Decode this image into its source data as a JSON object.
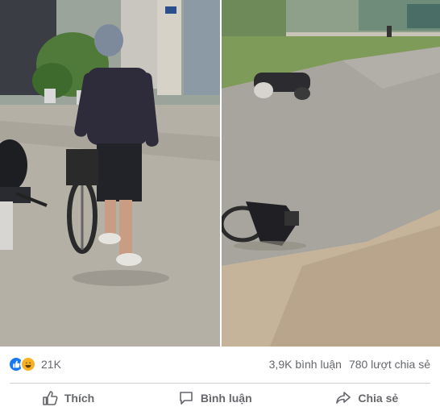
{
  "post": {
    "images": [
      {
        "alt_icon": "photo-man-with-bicycle"
      },
      {
        "alt_icon": "photo-crashed-motorbikes-road"
      }
    ]
  },
  "reactions": {
    "count": "21K",
    "icons": [
      "like-icon",
      "haha-icon"
    ]
  },
  "stats": {
    "comments": "3,9K bình luận",
    "shares": "780 lượt chia sẻ"
  },
  "actions": {
    "like_label": "Thích",
    "comment_label": "Bình luận",
    "share_label": "Chia sẻ"
  },
  "colors": {
    "like_blue": "#1877f2",
    "haha_yellow": "#f7b125",
    "text_gray": "#65676b",
    "divider": "#ced0d4"
  }
}
